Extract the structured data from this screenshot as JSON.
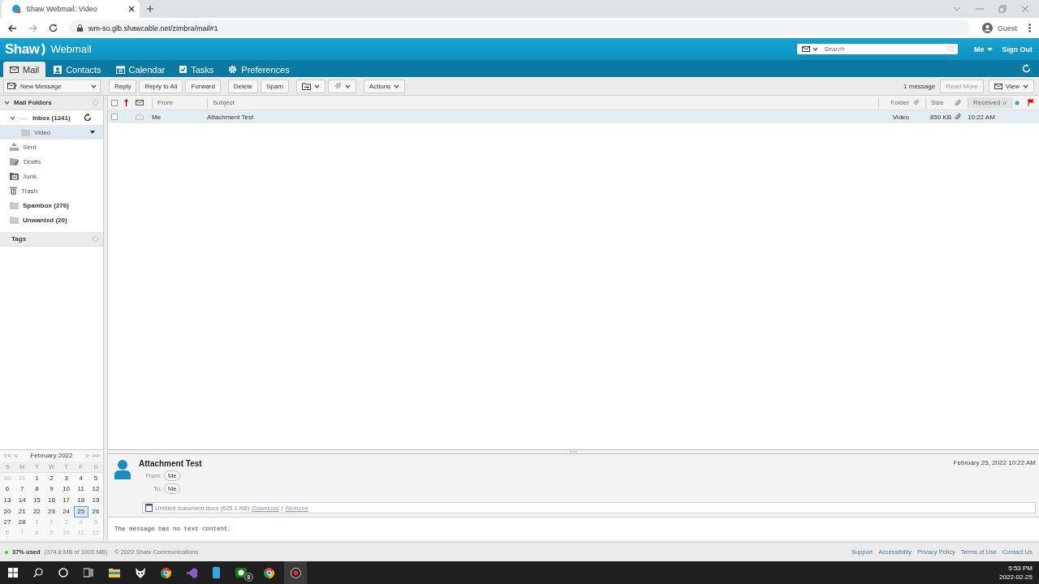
{
  "browser": {
    "tab_title": "Shaw Webmail: Video",
    "url": "wm-so.glb.shawcable.net/zimbra/mail#1",
    "profile": "Guest"
  },
  "header": {
    "brand": "Shaw",
    "product": "Webmail",
    "search_placeholder": "Search",
    "user": "Me",
    "sign_out": "Sign Out"
  },
  "tabs": [
    {
      "label": "Mail",
      "kind": "mail",
      "selected": true
    },
    {
      "label": "Contacts",
      "kind": "contacts",
      "selected": false
    },
    {
      "label": "Calendar",
      "kind": "calendar",
      "selected": false
    },
    {
      "label": "Tasks",
      "kind": "tasks",
      "selected": false
    },
    {
      "label": "Preferences",
      "kind": "preferences",
      "selected": false
    }
  ],
  "toolbar": {
    "new_message": "New Message",
    "buttons": [
      "Reply",
      "Reply to All",
      "Forward",
      "Delete",
      "Spam"
    ],
    "actions": "Actions",
    "count": "1 message",
    "read_more": "Read More",
    "view": "View"
  },
  "sidebar": {
    "title": "Mail Folders",
    "tags_title": "Tags",
    "folders": [
      {
        "name": "Inbox (1241)",
        "kind": "inbox",
        "unread": true,
        "selected": false,
        "expanded": true,
        "children": [
          {
            "name": "Video",
            "kind": "folder",
            "unread": false,
            "selected": true
          }
        ]
      },
      {
        "name": "Sent",
        "kind": "sent",
        "unread": false,
        "selected": false
      },
      {
        "name": "Drafts",
        "kind": "drafts",
        "unread": false,
        "selected": false
      },
      {
        "name": "Junk",
        "kind": "junk",
        "unread": false,
        "selected": false
      },
      {
        "name": "Trash",
        "kind": "trash",
        "unread": false,
        "selected": false
      },
      {
        "name": "Spambox (276)",
        "kind": "folder",
        "unread": true,
        "selected": false
      },
      {
        "name": "Unwanted (20)",
        "kind": "folder",
        "unread": true,
        "selected": false
      }
    ]
  },
  "calendar": {
    "month": "February 2022",
    "prev_year": "<<",
    "prev": "<",
    "next": ">",
    "next_year": ">>",
    "weekdays": [
      "S",
      "M",
      "T",
      "W",
      "T",
      "F",
      "S"
    ],
    "weeks": [
      [
        {
          "day": "30",
          "muted": true,
          "selected": false
        },
        {
          "day": "31",
          "muted": true,
          "selected": false
        },
        {
          "day": "1",
          "muted": false,
          "selected": false
        },
        {
          "day": "2",
          "muted": false,
          "selected": false
        },
        {
          "day": "3",
          "muted": false,
          "selected": false
        },
        {
          "day": "4",
          "muted": false,
          "selected": false
        },
        {
          "day": "5",
          "muted": false,
          "selected": false
        }
      ],
      [
        {
          "day": "6",
          "muted": false,
          "selected": false
        },
        {
          "day": "7",
          "muted": false,
          "selected": false
        },
        {
          "day": "8",
          "muted": false,
          "selected": false
        },
        {
          "day": "9",
          "muted": false,
          "selected": false
        },
        {
          "day": "10",
          "muted": false,
          "selected": false
        },
        {
          "day": "11",
          "muted": false,
          "selected": false
        },
        {
          "day": "12",
          "muted": false,
          "selected": false
        }
      ],
      [
        {
          "day": "13",
          "muted": false,
          "selected": false
        },
        {
          "day": "14",
          "muted": false,
          "selected": false
        },
        {
          "day": "15",
          "muted": false,
          "selected": false
        },
        {
          "day": "16",
          "muted": false,
          "selected": false
        },
        {
          "day": "17",
          "muted": false,
          "selected": false
        },
        {
          "day": "18",
          "muted": false,
          "selected": false
        },
        {
          "day": "19",
          "muted": false,
          "selected": false
        }
      ],
      [
        {
          "day": "20",
          "muted": false,
          "selected": false
        },
        {
          "day": "21",
          "muted": false,
          "selected": false
        },
        {
          "day": "22",
          "muted": false,
          "selected": false
        },
        {
          "day": "23",
          "muted": false,
          "selected": false
        },
        {
          "day": "24",
          "muted": false,
          "selected": false
        },
        {
          "day": "25",
          "muted": false,
          "selected": true
        },
        {
          "day": "26",
          "muted": false,
          "selected": false
        }
      ],
      [
        {
          "day": "27",
          "muted": false,
          "selected": false
        },
        {
          "day": "28",
          "muted": false,
          "selected": false
        },
        {
          "day": "1",
          "muted": true,
          "selected": false
        },
        {
          "day": "2",
          "muted": true,
          "selected": false
        },
        {
          "day": "3",
          "muted": true,
          "selected": false
        },
        {
          "day": "4",
          "muted": true,
          "selected": false
        },
        {
          "day": "5",
          "muted": true,
          "selected": false
        }
      ],
      [
        {
          "day": "6",
          "muted": true,
          "selected": false
        },
        {
          "day": "7",
          "muted": true,
          "selected": false
        },
        {
          "day": "8",
          "muted": true,
          "selected": false
        },
        {
          "day": "9",
          "muted": true,
          "selected": false
        },
        {
          "day": "10",
          "muted": true,
          "selected": false
        },
        {
          "day": "11",
          "muted": true,
          "selected": false
        },
        {
          "day": "12",
          "muted": true,
          "selected": false
        }
      ]
    ]
  },
  "list": {
    "all_checked": false,
    "columns": {
      "from": "From",
      "subject": "Subject",
      "folder": "Folder",
      "size": "Size",
      "received": "Received"
    },
    "rows": [
      {
        "from": "Me",
        "subject": "Attachment Test",
        "folder": "Video",
        "size": "859 KB",
        "received": "10:22 AM",
        "selected": true,
        "checked": false
      }
    ]
  },
  "message": {
    "subject": "Attachment Test",
    "date": "February 25, 2022 10:22 AM",
    "from_label": "From:",
    "from": "Me",
    "to_label": "To:",
    "to": "Me",
    "attachment": "Untitled document.docx (625.1 KB)",
    "download": "Download",
    "separator": "|",
    "remove": "Remove",
    "body": "The message has no text content."
  },
  "footer": {
    "quota": "37% used",
    "quota_detail": "(374.8 MB of 1000 MB)",
    "copyright": "© 2020 Shaw Communications",
    "links": [
      "Support",
      "Accessibility",
      "Privacy Policy",
      "Terms of Use",
      "Contact Us"
    ]
  },
  "taskbar": {
    "badge": "8",
    "time": "5:53 PM",
    "date": "2022-02-25"
  }
}
